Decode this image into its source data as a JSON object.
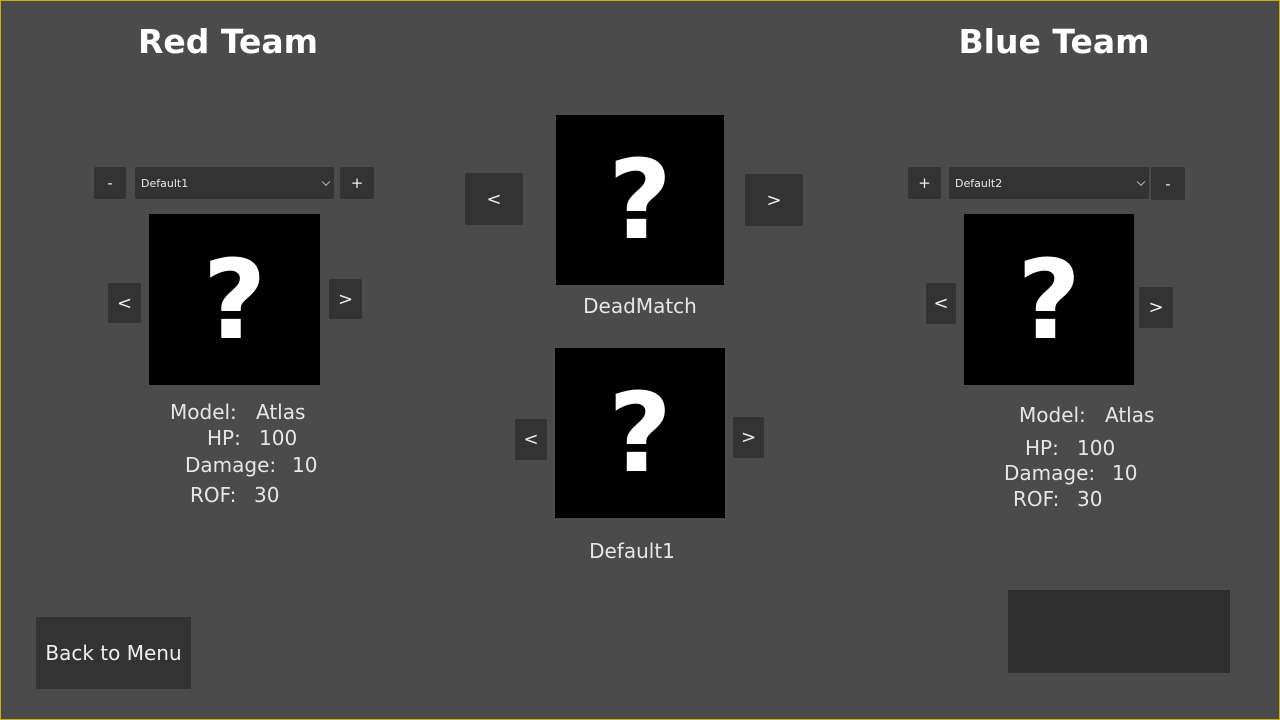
{
  "red_team": {
    "title": "Red Team",
    "minus_label": "-",
    "plus_label": "+",
    "loadout_selected": "Default1",
    "prev_label": "<",
    "next_label": ">",
    "preview_glyph": "?",
    "stats": {
      "model_label": "Model:",
      "model_value": "Atlas",
      "hp_label": "HP:",
      "hp_value": "100",
      "damage_label": "Damage:",
      "damage_value": "10",
      "rof_label": "ROF:",
      "rof_value": "30"
    }
  },
  "blue_team": {
    "title": "Blue Team",
    "plus_label": "+",
    "minus_label": "-",
    "loadout_selected": "Default2",
    "prev_label": "<",
    "next_label": ">",
    "preview_glyph": "?",
    "stats": {
      "model_label": "Model:",
      "model_value": "Atlas",
      "hp_label": "HP:",
      "hp_value": "100",
      "damage_label": "Damage:",
      "damage_value": "10",
      "rof_label": "ROF:",
      "rof_value": "30"
    }
  },
  "game_mode": {
    "name": "DeadMatch",
    "prev_label": "<",
    "next_label": ">",
    "preview_glyph": "?"
  },
  "map": {
    "name": "Default1",
    "prev_label": "<",
    "next_label": ">",
    "preview_glyph": "?"
  },
  "footer": {
    "back_label": "Back to Menu"
  },
  "colors": {
    "background": "#4b4b4b",
    "button": "#333333",
    "preview_bg": "#000000",
    "border": "#c8b400"
  }
}
